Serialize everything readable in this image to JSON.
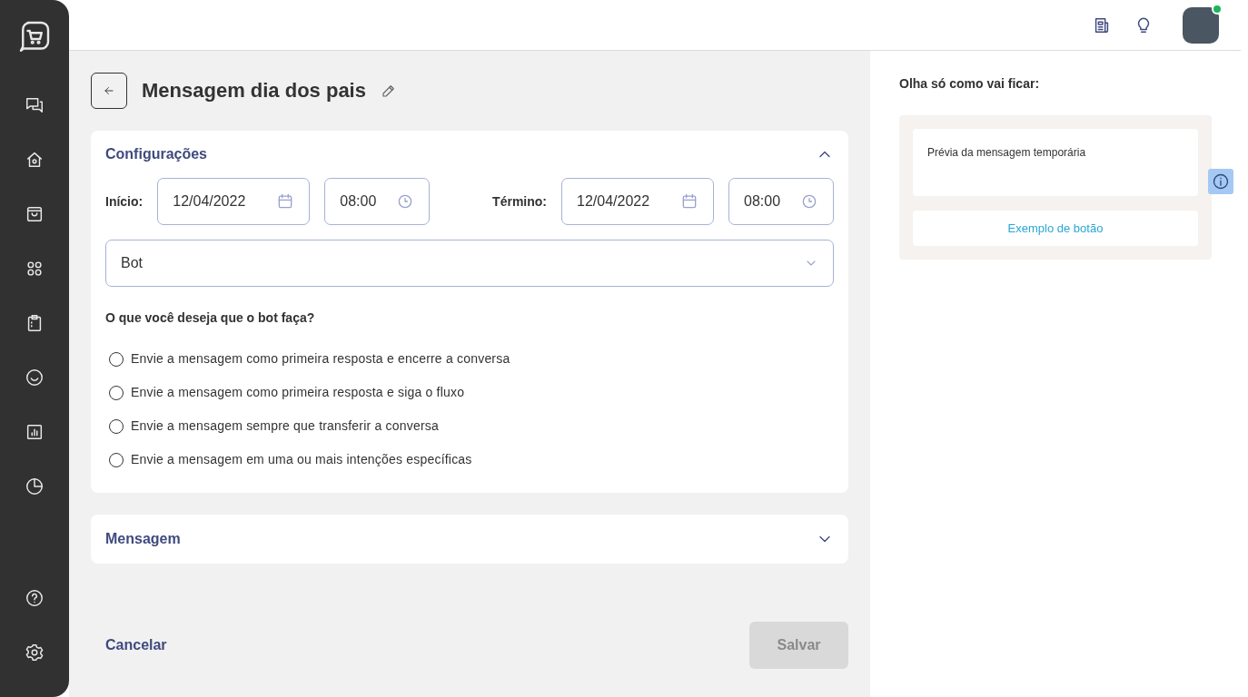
{
  "header": {
    "user": {
      "online": true
    }
  },
  "page_title": "Mensagem dia dos pais",
  "config": {
    "title": "Configurações",
    "expanded": true,
    "start": {
      "label": "Início:",
      "date": "12/04/2022",
      "time": "08:00"
    },
    "end": {
      "label": "Término:",
      "date": "12/04/2022",
      "time": "08:00"
    },
    "channel": "Bot",
    "question": "O que você deseja que o bot faça?",
    "options": [
      {
        "label": "Envie a mensagem como primeira resposta e encerre a conversa",
        "selected": false
      },
      {
        "label": "Envie a mensagem como primeira resposta e siga o fluxo",
        "selected": false
      },
      {
        "label": "Envie a mensagem sempre que transferir a conversa",
        "selected": false
      },
      {
        "label": "Envie a mensagem em uma ou mais intenções específicas",
        "selected": false
      }
    ]
  },
  "message_section": {
    "title": "Mensagem",
    "expanded": false
  },
  "actions": {
    "cancel": "Cancelar",
    "save": "Salvar",
    "save_disabled": true
  },
  "preview": {
    "title": "Olha só como vai ficar:",
    "message": "Prévia da mensagem temporária",
    "button": "Exemplo de botão"
  }
}
